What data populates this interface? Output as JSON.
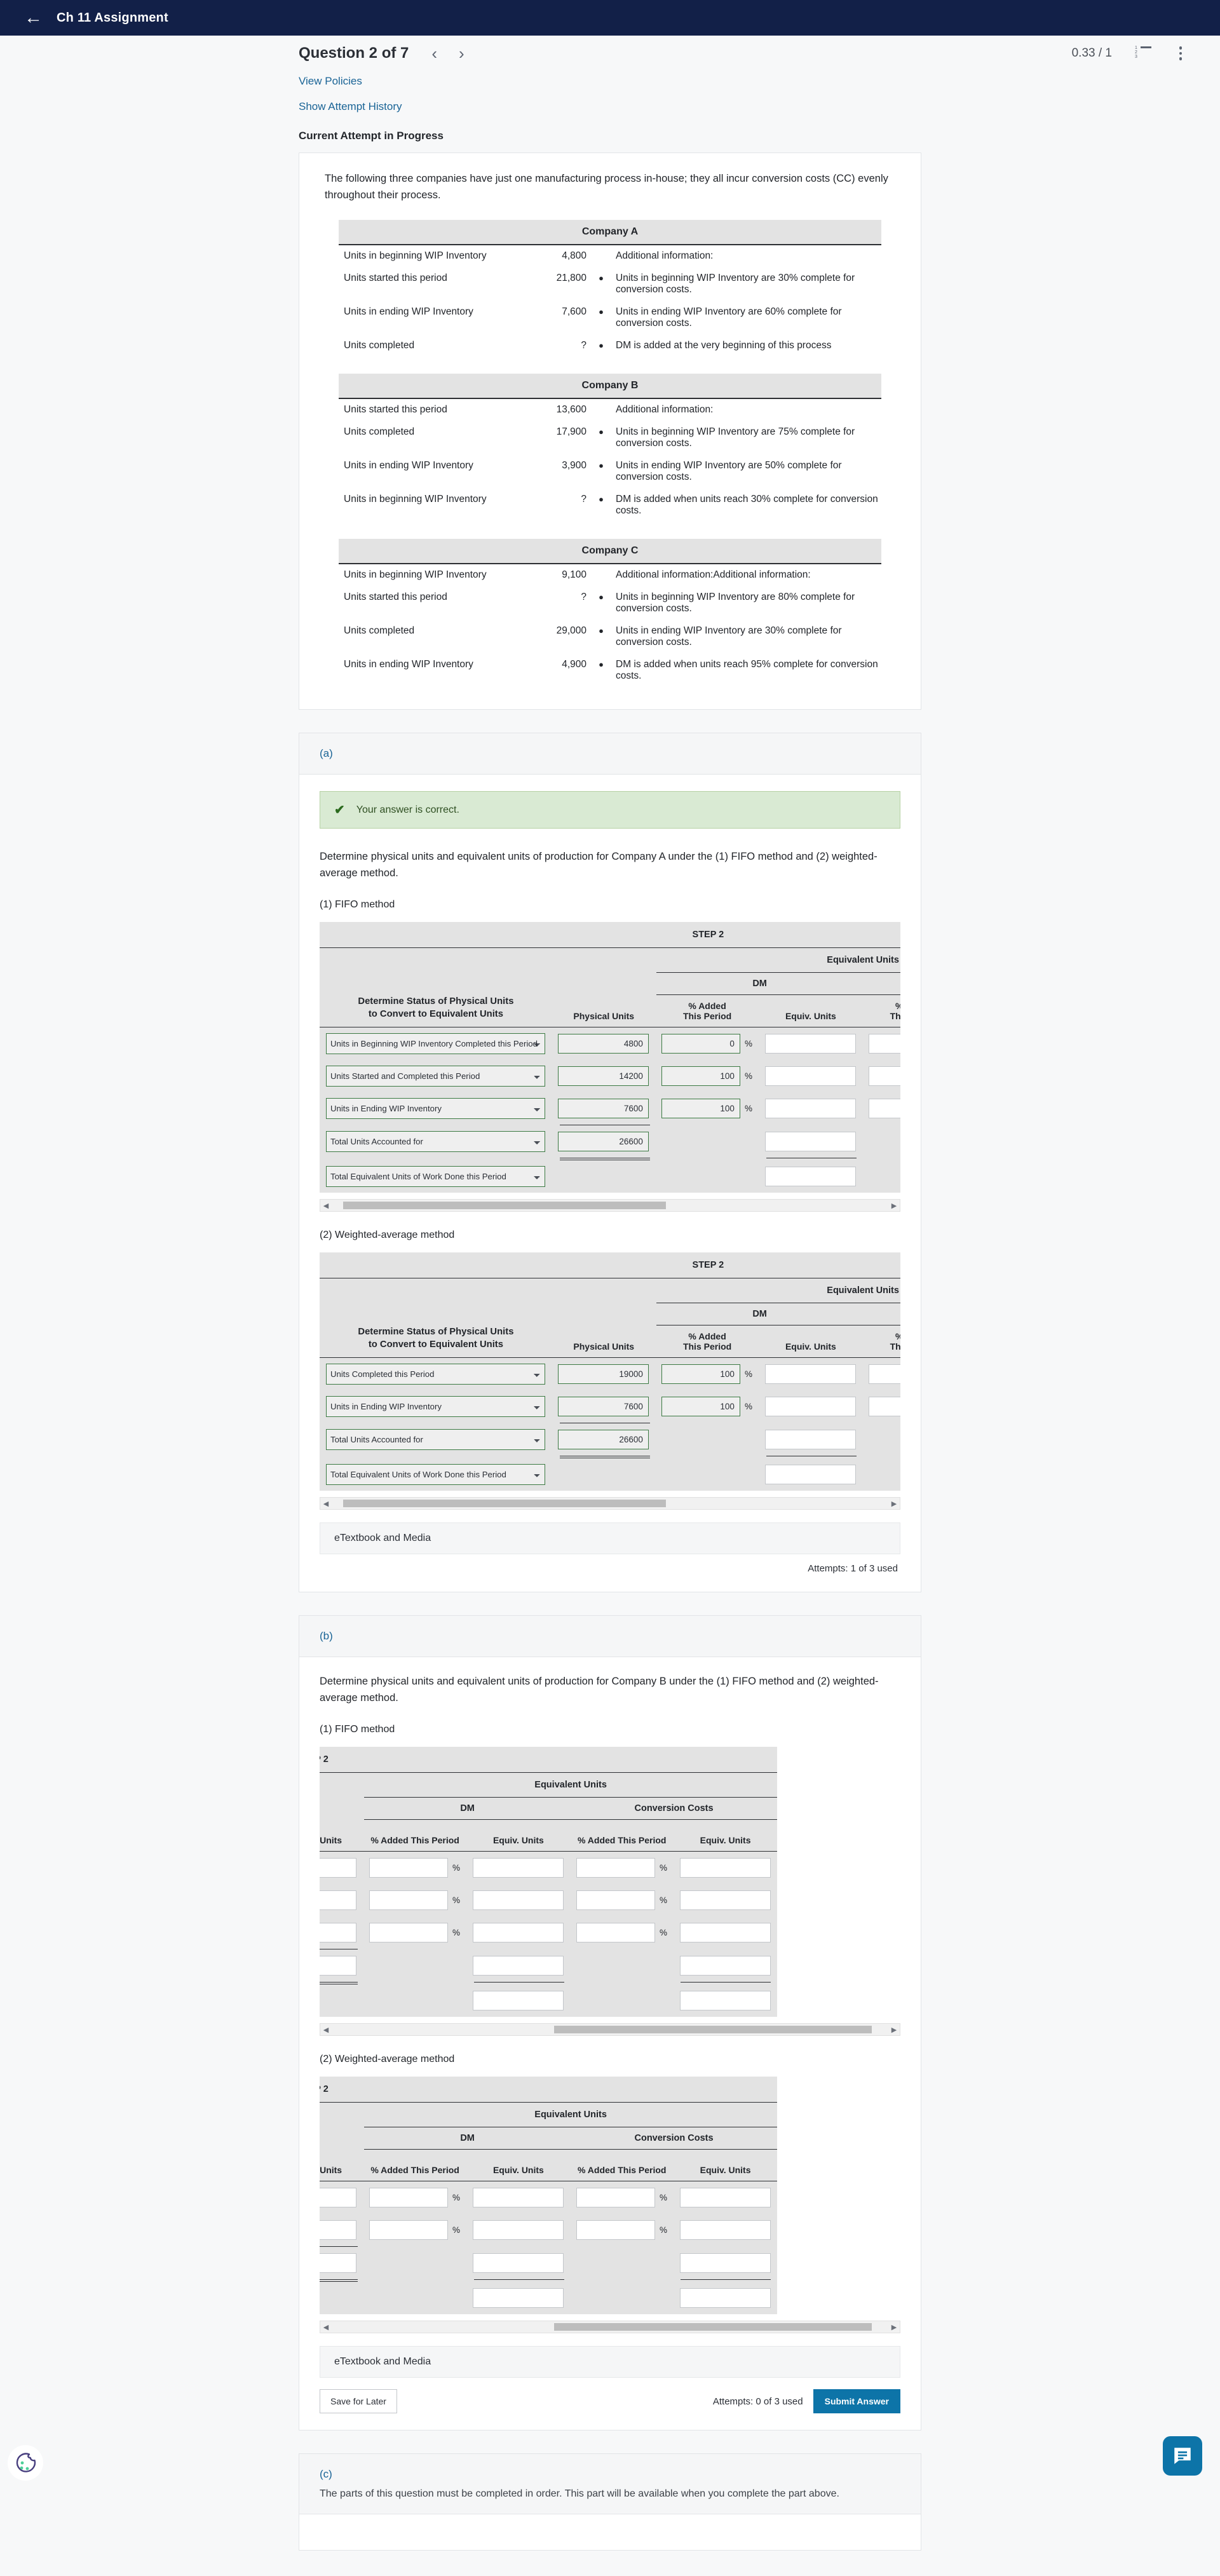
{
  "topbar": {
    "title": "Ch 11 Assignment",
    "back_icon": "arrow-left-icon"
  },
  "question_bar": {
    "title": "Question 2 of 7",
    "prev": "‹",
    "next": "›",
    "score": "0.33 / 1",
    "list_icon": "numbered-list-icon",
    "menu_icon": "kebab-menu-icon"
  },
  "links": {
    "view_policies": "View Policies",
    "show_attempt_history": "Show Attempt History"
  },
  "current_attempt_heading": "Current Attempt in Progress",
  "intro": "The following three companies have just one manufacturing process in-house; they all incur conversion costs (CC) evenly throughout their process.",
  "companies": [
    {
      "name": "Company A",
      "rows": [
        {
          "label": "Units in beginning WIP Inventory",
          "value": "4,800",
          "note": "Additional information:",
          "bullet": false
        },
        {
          "label": "Units started this period",
          "value": "21,800",
          "note": "Units in beginning WIP Inventory are 30% complete for conversion costs.",
          "bullet": true
        },
        {
          "label": "Units in ending WIP Inventory",
          "value": "7,600",
          "note": "Units in ending WIP Inventory are 60% complete for conversion costs.",
          "bullet": true
        },
        {
          "label": "Units completed",
          "value": "?",
          "note": "DM is added at the very beginning of this process",
          "bullet": true
        }
      ]
    },
    {
      "name": "Company B",
      "rows": [
        {
          "label": "Units started this period",
          "value": "13,600",
          "note": "Additional information:",
          "bullet": false
        },
        {
          "label": "Units completed",
          "value": "17,900",
          "note": "Units in beginning WIP Inventory are 75% complete for conversion costs.",
          "bullet": true
        },
        {
          "label": "Units in ending WIP Inventory",
          "value": "3,900",
          "note": "Units in ending WIP Inventory are 50% complete for conversion costs.",
          "bullet": true
        },
        {
          "label": "Units in beginning WIP Inventory",
          "value": "?",
          "note": "DM is added when units reach 30% complete for conversion costs.",
          "bullet": true
        }
      ]
    },
    {
      "name": "Company C",
      "rows": [
        {
          "label": "Units in beginning WIP Inventory",
          "value": "9,100",
          "note": "Additional information:Additional information:",
          "bullet": false
        },
        {
          "label": "Units started this period",
          "value": "?",
          "note": "Units in beginning WIP Inventory are 80% complete for conversion costs.",
          "bullet": true
        },
        {
          "label": "Units completed",
          "value": "29,000",
          "note": "Units in ending WIP Inventory are 30% complete for conversion costs.",
          "bullet": true
        },
        {
          "label": "Units in ending WIP Inventory",
          "value": "4,900",
          "note": "DM is added when units reach 95% complete for conversion costs.",
          "bullet": true
        }
      ]
    }
  ],
  "part_a": {
    "letter": "(a)",
    "alert": {
      "icon": "check-icon",
      "text": "Your answer is correct."
    },
    "prompt": "Determine physical units and equivalent units of production for Company A under the (1) FIFO method and (2) weighted-average method.",
    "fifo_label": "(1) FIFO method",
    "wavg_label": "(2) Weighted-average method",
    "headers": {
      "step2": "STEP 2",
      "desc_line1": "Determine Status of Physical Units",
      "desc_line2": "to Convert to Equivalent Units",
      "physical_units": "Physical Units",
      "dm": "DM",
      "conversion_costs": "Conversion Costs",
      "equivalent_units": "Equivalent Units",
      "pct_added": "% Added This Period",
      "pct_added_l1": "% Added",
      "pct_added_l2": "This Period",
      "equiv_units": "Equiv. Units",
      "pct_symbol": "%"
    },
    "fifo_rows": [
      {
        "desc": "Units in Beginning WIP Inventory Completed this Period",
        "physical": "4800",
        "dm_pct": "0",
        "dm_units": "",
        "cc_pct": "",
        "cc_units": ""
      },
      {
        "desc": "Units Started and Completed this Period",
        "physical": "14200",
        "dm_pct": "100",
        "dm_units": "",
        "cc_pct": "",
        "cc_units": ""
      },
      {
        "desc": "Units in Ending WIP Inventory",
        "physical": "7600",
        "dm_pct": "100",
        "dm_units": "",
        "cc_pct": "",
        "cc_units": ""
      },
      {
        "desc": "Total Units Accounted for",
        "physical": "26600",
        "dm_pct": null,
        "dm_units": "",
        "cc_pct": null,
        "cc_units": ""
      },
      {
        "desc": "Total Equivalent Units of Work Done this Period",
        "physical": null,
        "dm_pct": null,
        "dm_units": "",
        "cc_pct": null,
        "cc_units": ""
      }
    ],
    "wavg_rows": [
      {
        "desc": "Units Completed this Period",
        "physical": "19000",
        "dm_pct": "100",
        "dm_units": "",
        "cc_pct": "",
        "cc_units": ""
      },
      {
        "desc": "Units in Ending WIP Inventory",
        "physical": "7600",
        "dm_pct": "100",
        "dm_units": "",
        "cc_pct": "",
        "cc_units": ""
      },
      {
        "desc": "Total Units Accounted for",
        "physical": "26600",
        "dm_pct": null,
        "dm_units": "",
        "cc_pct": null,
        "cc_units": ""
      },
      {
        "desc": "Total Equivalent Units of Work Done this Period",
        "physical": null,
        "dm_pct": null,
        "dm_units": "",
        "cc_pct": null,
        "cc_units": ""
      }
    ],
    "etextbook": "eTextbook and Media",
    "attempts": "Attempts: 1 of 3 used"
  },
  "part_b": {
    "letter": "(b)",
    "prompt": "Determine physical units and equivalent units of production for Company B under the (1) FIFO method and (2) weighted-average method.",
    "fifo_label": "(1) FIFO method",
    "wavg_label": "(2) Weighted-average method",
    "fifo_rows": [
      {
        "desc": "",
        "physical": "",
        "dm_pct": "",
        "dm_units": "",
        "cc_pct": "",
        "cc_units": ""
      },
      {
        "desc": "",
        "physical": "",
        "dm_pct": "",
        "dm_units": "",
        "cc_pct": "",
        "cc_units": ""
      },
      {
        "desc": "",
        "physical": "",
        "dm_pct": "",
        "dm_units": "",
        "cc_pct": "",
        "cc_units": ""
      },
      {
        "desc": "",
        "physical": "",
        "dm_pct": null,
        "dm_units": "",
        "cc_pct": null,
        "cc_units": ""
      },
      {
        "desc": "",
        "physical": null,
        "dm_pct": null,
        "dm_units": "",
        "cc_pct": null,
        "cc_units": ""
      }
    ],
    "wavg_rows": [
      {
        "desc": "",
        "physical": "",
        "dm_pct": "",
        "dm_units": "",
        "cc_pct": "",
        "cc_units": ""
      },
      {
        "desc": "",
        "physical": "",
        "dm_pct": "",
        "dm_units": "",
        "cc_pct": "",
        "cc_units": ""
      },
      {
        "desc": "",
        "physical": "",
        "dm_pct": null,
        "dm_units": "",
        "cc_pct": null,
        "cc_units": ""
      },
      {
        "desc": "",
        "physical": null,
        "dm_pct": null,
        "dm_units": "",
        "cc_pct": null,
        "cc_units": ""
      }
    ],
    "etextbook": "eTextbook and Media",
    "attempts": "Attempts: 0 of 3 used",
    "save_label": "Save for Later",
    "submit_label": "Submit Answer"
  },
  "part_c": {
    "letter": "(c)",
    "message": "The parts of this question must be completed in order. This part will be available when you complete the part above."
  },
  "widgets": {
    "cookie_icon": "cookie-icon",
    "chat_icon": "chat-bubble-icon"
  },
  "colors": {
    "navy": "#122048",
    "link": "#1a6496",
    "accent": "#0d74a8",
    "success_bg": "#d9ead3",
    "input_border": "#3c7a43"
  }
}
